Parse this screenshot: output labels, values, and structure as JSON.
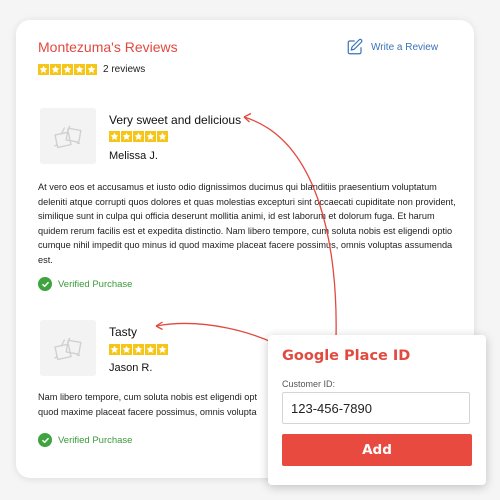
{
  "header": {
    "title": "Montezuma's Reviews",
    "write_review_label": "Write a Review",
    "review_count_label": "2 reviews",
    "rating": 5
  },
  "reviews": [
    {
      "title": "Very sweet and delicious",
      "author": "Melissa J.",
      "rating": 5,
      "body": "At vero eos et accusamus et iusto odio dignissimos ducimus qui blanditiis praesentium voluptatum deleniti atque corrupti quos dolores et quas molestias excepturi sint occaecati cupiditate non provident, similique sunt in culpa qui officia deserunt mollitia animi, id est laborum et dolorum fuga. Et harum quidem rerum facilis est et expedita distinctio. Nam libero tempore, cum soluta nobis est eligendi optio cumque nihil impedit quo minus id quod maxime placeat facere possimus, omnis voluptas assumenda est.",
      "verified_label": "Verified Purchase"
    },
    {
      "title": "Tasty",
      "author": "Jason R.",
      "rating": 5,
      "body": "Nam libero tempore, cum soluta nobis est eligendi opt quod maxime placeat facere possimus, omnis volupta",
      "verified_label": "Verified Purchase"
    }
  ],
  "popup": {
    "title": "Google Place ID",
    "field_label": "Customer ID:",
    "field_value": "123-456-7890",
    "button_label": "Add"
  },
  "icons": {
    "write_review": "pencil-square-icon",
    "thumbnail": "gift-placeholder-icon",
    "verified": "check-circle-icon",
    "star": "star-icon"
  },
  "colors": {
    "accent_red": "#e2493f",
    "link_blue": "#3a73b8",
    "star_gold": "#f5c518",
    "verified_green": "#3fa33f",
    "button_red": "#e84a3f"
  }
}
